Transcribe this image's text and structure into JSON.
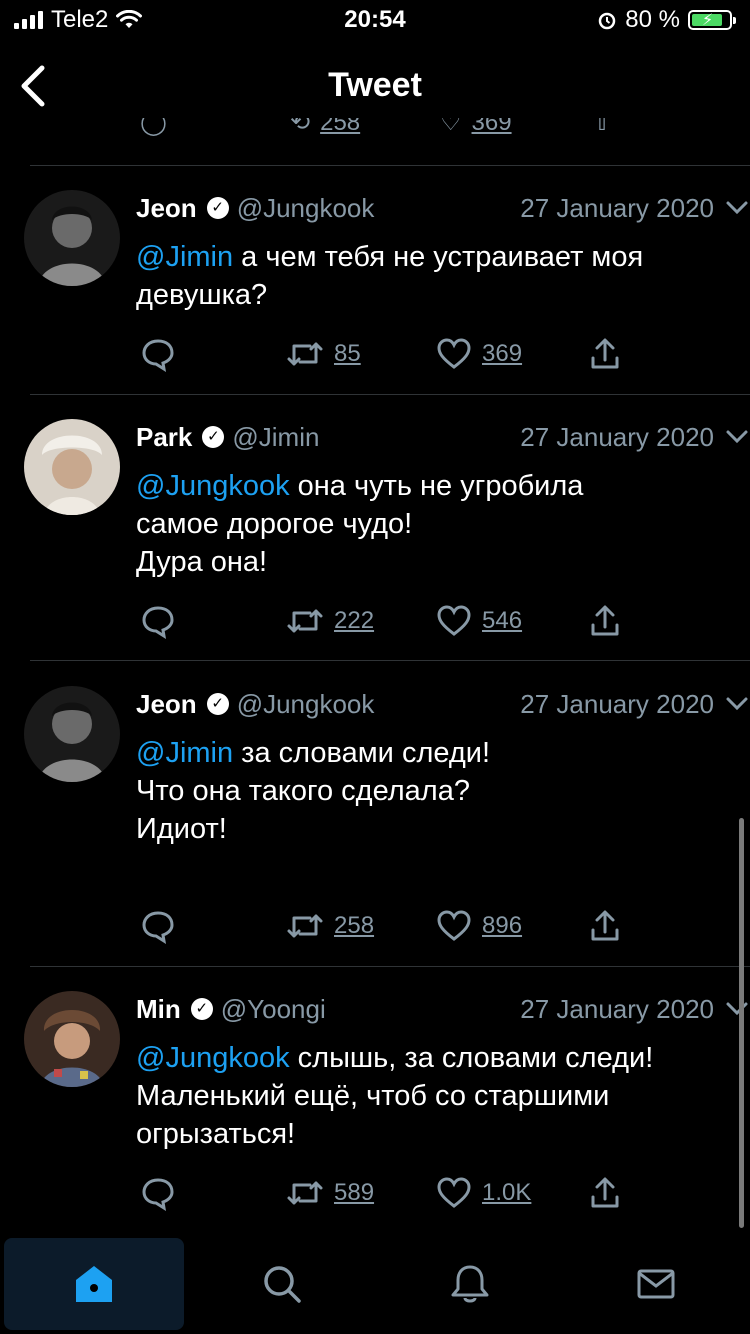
{
  "status_bar": {
    "carrier": "Tele2",
    "time": "20:54",
    "battery": "80 %"
  },
  "header": {
    "title": "Tweet"
  },
  "previous_tweet": {
    "retweets": "258",
    "likes": "369"
  },
  "tweets": [
    {
      "name": "Jeon",
      "handle": "@Jungkook",
      "date": "27 January 2020",
      "mention": "@Jimin",
      "line1": " а чем тебя не устраивает моя",
      "line2": "девушка?",
      "line3": "",
      "retweets": "85",
      "likes": "369"
    },
    {
      "name": "Park",
      "handle": "@Jimin",
      "date": "27 January 2020",
      "mention": "@Jungkook",
      "line1": " она чуть не угробила",
      "line2": "самое дорогое чудо!",
      "line3": "Дура она!",
      "retweets": "222",
      "likes": "546"
    },
    {
      "name": "Jeon",
      "handle": "@Jungkook",
      "date": "27 January 2020",
      "mention": "@Jimin",
      "line1": " за словами следи!",
      "line2": "Что она такого сделала?",
      "line3": "Идиот!",
      "retweets": "258",
      "likes": "896"
    },
    {
      "name": "Min",
      "handle": "@Yoongi",
      "date": "27 January 2020",
      "mention": "@Jungkook",
      "line1": " слышь, за словами следи!",
      "line2": "Маленький ещё, чтоб со старшими",
      "line3": "огрызаться!",
      "retweets": "589",
      "likes": "1.0K"
    }
  ],
  "tabs": [
    {
      "icon": "home-icon"
    },
    {
      "icon": "search-icon"
    },
    {
      "icon": "bell-icon"
    },
    {
      "icon": "mail-icon"
    }
  ],
  "colors": {
    "accent": "#1da1f2",
    "muted": "#8899a6",
    "background": "#000000",
    "battery": "#4cd964"
  }
}
